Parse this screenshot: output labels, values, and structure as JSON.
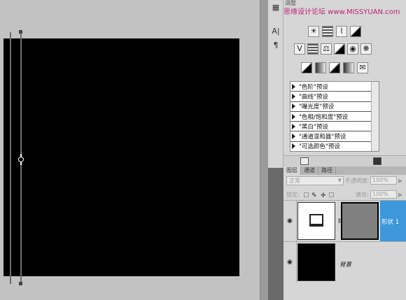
{
  "adjustments": {
    "title": "调整",
    "watermark": "思缘设计论坛  www.MISSYUAN.com",
    "presets": [
      "\"色阶\"预设",
      "\"曲线\"预设",
      "\"曝光度\"预设",
      "\"色相/饱和度\"预设",
      "\"黑白\"预设",
      "\"通道混和器\"预设",
      "\"可选颜色\"预设"
    ]
  },
  "dock": {
    "char_icon": "A|",
    "para_icon": "¶"
  },
  "layers": {
    "tabs": [
      "图层",
      "通道",
      "路径"
    ],
    "blend_mode": "正常",
    "opacity_label": "不透明度:",
    "opacity_value": "100%",
    "lock_label": "锁定:",
    "fill_label": "填充:",
    "fill_value": "100%",
    "items": [
      {
        "name": "形状 1",
        "selected": true
      },
      {
        "name": "背景",
        "selected": false
      }
    ]
  },
  "colors": {
    "selection": "#3d98d9",
    "canvas": "#000000",
    "watermark": "#c01e7a"
  }
}
